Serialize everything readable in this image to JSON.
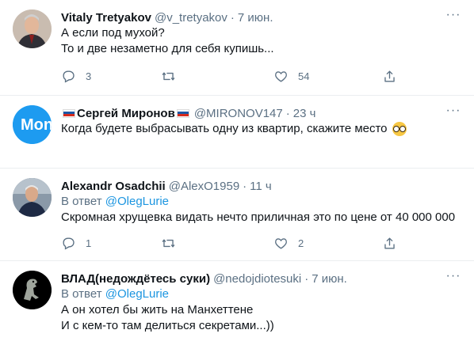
{
  "tweets": [
    {
      "name": "Vitaly Tretyakov",
      "handle": "@v_tretyakov",
      "dot": "·",
      "time": "7 июн.",
      "lines": [
        "А если под мухой?",
        "То и две незаметно для себя купишь..."
      ],
      "reply_count": "3",
      "retweet_count": "",
      "like_count": "54"
    },
    {
      "name": "Сергей Миронов",
      "handle": "@MIRONOV147",
      "dot": "·",
      "time": "23 ч",
      "lines": [
        "Когда будете выбрасывать одну из квартир, скажите место"
      ],
      "avatar_text": "МoneyTT",
      "reply_count": "",
      "retweet_count": "",
      "like_count": ""
    },
    {
      "name": "Alexandr Osadchii",
      "handle": "@AlexO1959",
      "dot": "·",
      "time": "11 ч",
      "reply_prefix": "В ответ",
      "reply_target": "@OlegLurie",
      "lines": [
        "Скромная хрущевка видать нечто приличная это по цене от 40 000 000"
      ],
      "reply_count": "1",
      "retweet_count": "",
      "like_count": "2"
    },
    {
      "name": "ВЛАД(недождётесь суки)",
      "handle": "@nedojdiotesuki",
      "dot": "·",
      "time": "7 июн.",
      "reply_prefix": "В ответ",
      "reply_target": "@OlegLurie",
      "lines": [
        "А он хотел бы жить на Манхеттене",
        "И с кем-то там делиться секретами...))"
      ]
    }
  ],
  "colors": {
    "text": "#0f1419",
    "muted": "#5b7083",
    "link": "#1b95e0",
    "divider": "#ebeef0"
  },
  "icons": [
    "reply-icon",
    "retweet-icon",
    "like-icon",
    "share-icon",
    "more-icon",
    "russia-flag-icon",
    "nerd-face-emoji"
  ]
}
